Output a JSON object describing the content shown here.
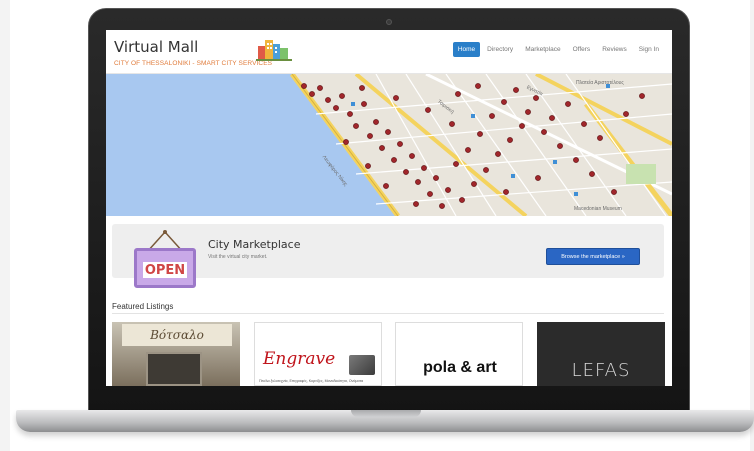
{
  "site": {
    "title": "Virtual Mall",
    "subtitle": "CITY OF THESSALONIKI - SMART CITY SERVICES"
  },
  "nav": {
    "items": [
      {
        "label": "Home",
        "active": true
      },
      {
        "label": "Directory",
        "active": false
      },
      {
        "label": "Marketplace",
        "active": false
      },
      {
        "label": "Offers",
        "active": false
      },
      {
        "label": "Reviews",
        "active": false
      },
      {
        "label": "Sign In",
        "active": false
      }
    ]
  },
  "map": {
    "labels": {
      "a": "Macedonian Museum",
      "b": "Πλατεία Αριστοτέλους",
      "c": "Λεωφόρος Νίκης",
      "d": "Τσιμισκή",
      "e": "Εγνατία"
    }
  },
  "banner": {
    "sign_text": "OPEN",
    "title": "City Marketplace",
    "subtitle": "Visit the virtual city market.",
    "button_label": "Browse the marketplace »"
  },
  "featured": {
    "title": "Featured Listings",
    "listings": [
      {
        "name": "Βότσαλο"
      },
      {
        "name": "Engrave",
        "sub": "Πινέλα ξυλοτεχνία, Επιγραφές, Κορνίζες, Μοναδικότητα, Ονόματα"
      },
      {
        "name": "pola & art"
      },
      {
        "name": "LEFAS"
      }
    ]
  },
  "colors": {
    "accent": "#2a7fc9",
    "button": "#2a66c4",
    "subtitle": "#e07b3a",
    "sea": "#a8c8f0",
    "marker": "#a0262b"
  }
}
